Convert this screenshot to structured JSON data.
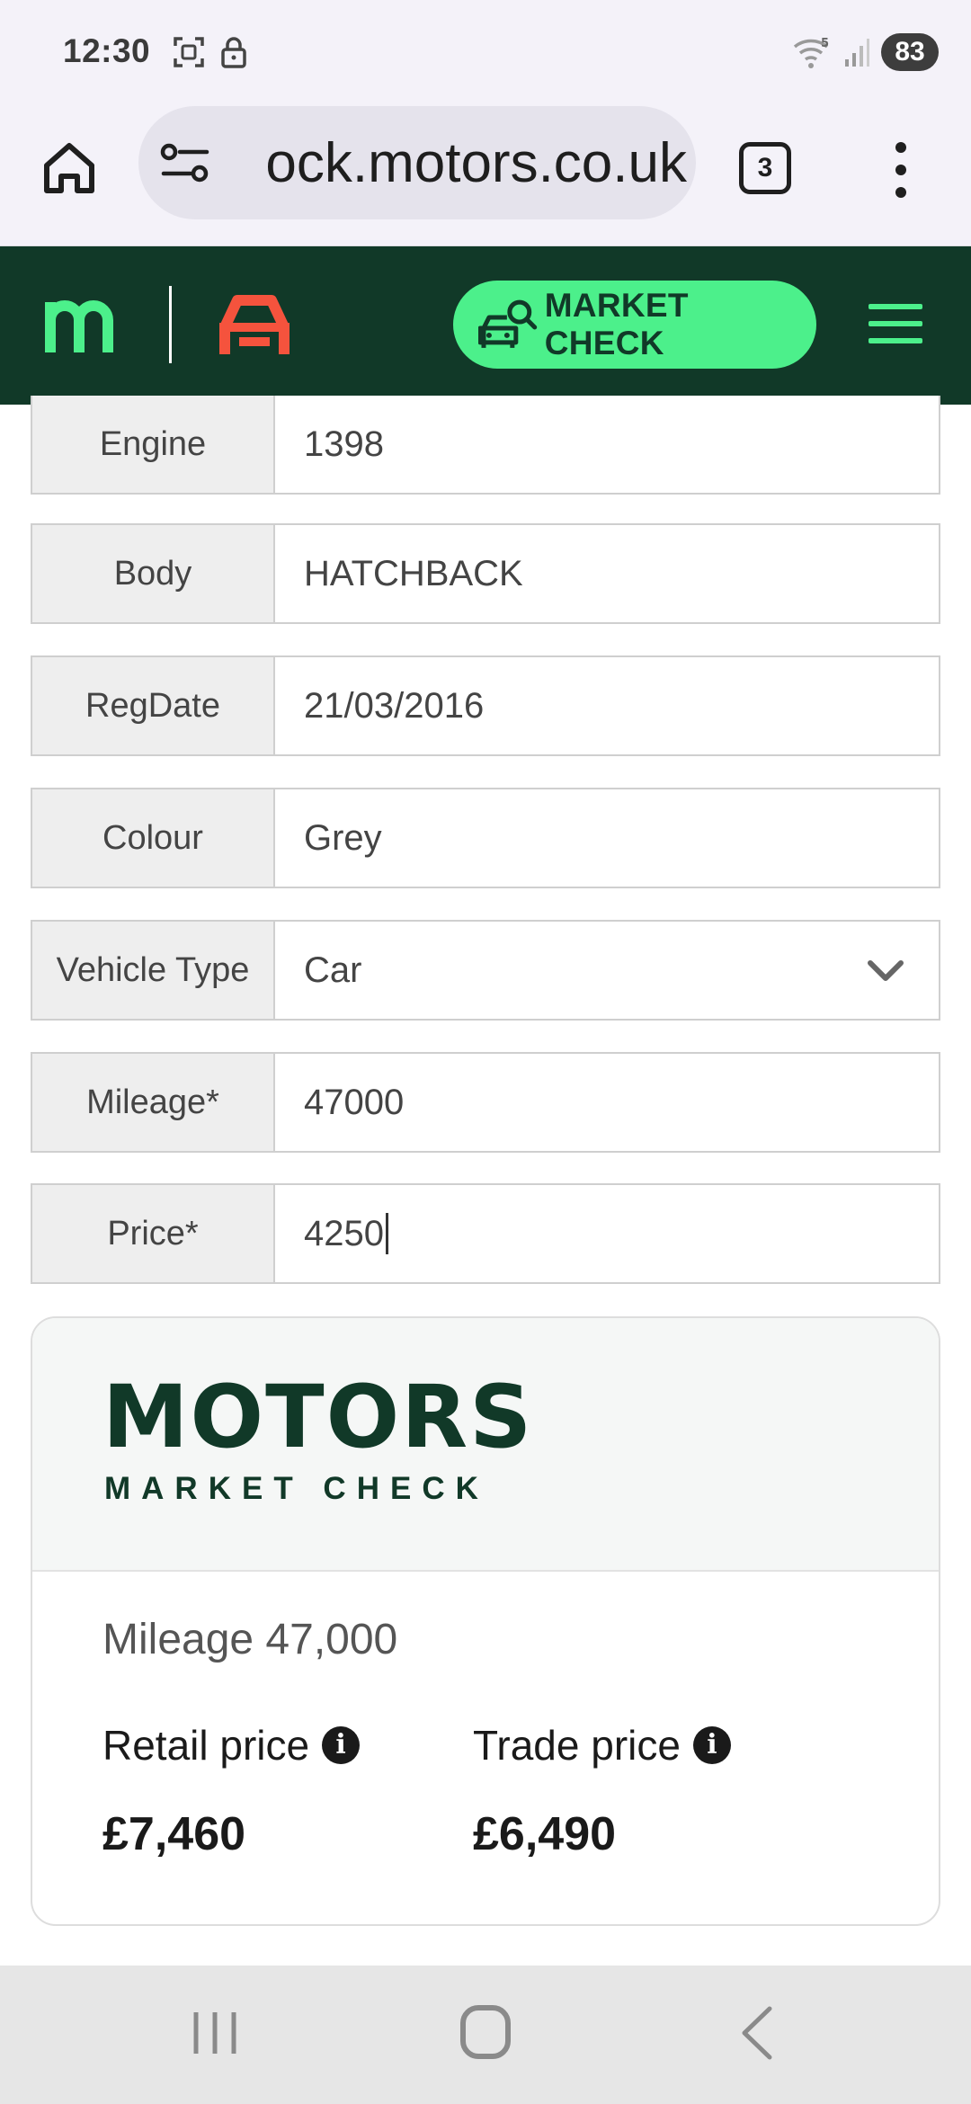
{
  "status_bar": {
    "time": "12:30",
    "battery": "83",
    "icons": [
      "screenshot-icon",
      "lock-icon",
      "wifi-icon",
      "signal-icon"
    ]
  },
  "browser": {
    "url": "ock.motors.co.uk",
    "tab_count": "3",
    "icons": [
      "home-icon",
      "site-settings-icon",
      "more-vert-icon"
    ]
  },
  "site_header": {
    "market_check_label": "MARKET CHECK",
    "colors": {
      "header_bg": "#113928",
      "accent_green": "#4cf08b",
      "accent_red": "#f5533d"
    }
  },
  "form": {
    "rows": [
      {
        "label": "Engine",
        "value": "1398"
      },
      {
        "label": "Body",
        "value": "HATCHBACK"
      },
      {
        "label": "RegDate",
        "value": "21/03/2016"
      },
      {
        "label": "Colour",
        "value": "Grey"
      },
      {
        "label": "Vehicle Type",
        "value": "Car"
      },
      {
        "label": "Mileage*",
        "value": "47000"
      },
      {
        "label": "Price*",
        "value": "4250"
      }
    ]
  },
  "market_check_card": {
    "brand_title": "MOTORS",
    "brand_subtitle": "MARKET CHECK",
    "mileage_text": "Mileage 47,000",
    "retail_label": "Retail price",
    "retail_value": "£7,460",
    "trade_label": "Trade price",
    "trade_value": "£6,490"
  },
  "nav_bar": {
    "icons": [
      "recent-apps-icon",
      "home-nav-icon",
      "back-icon"
    ]
  }
}
